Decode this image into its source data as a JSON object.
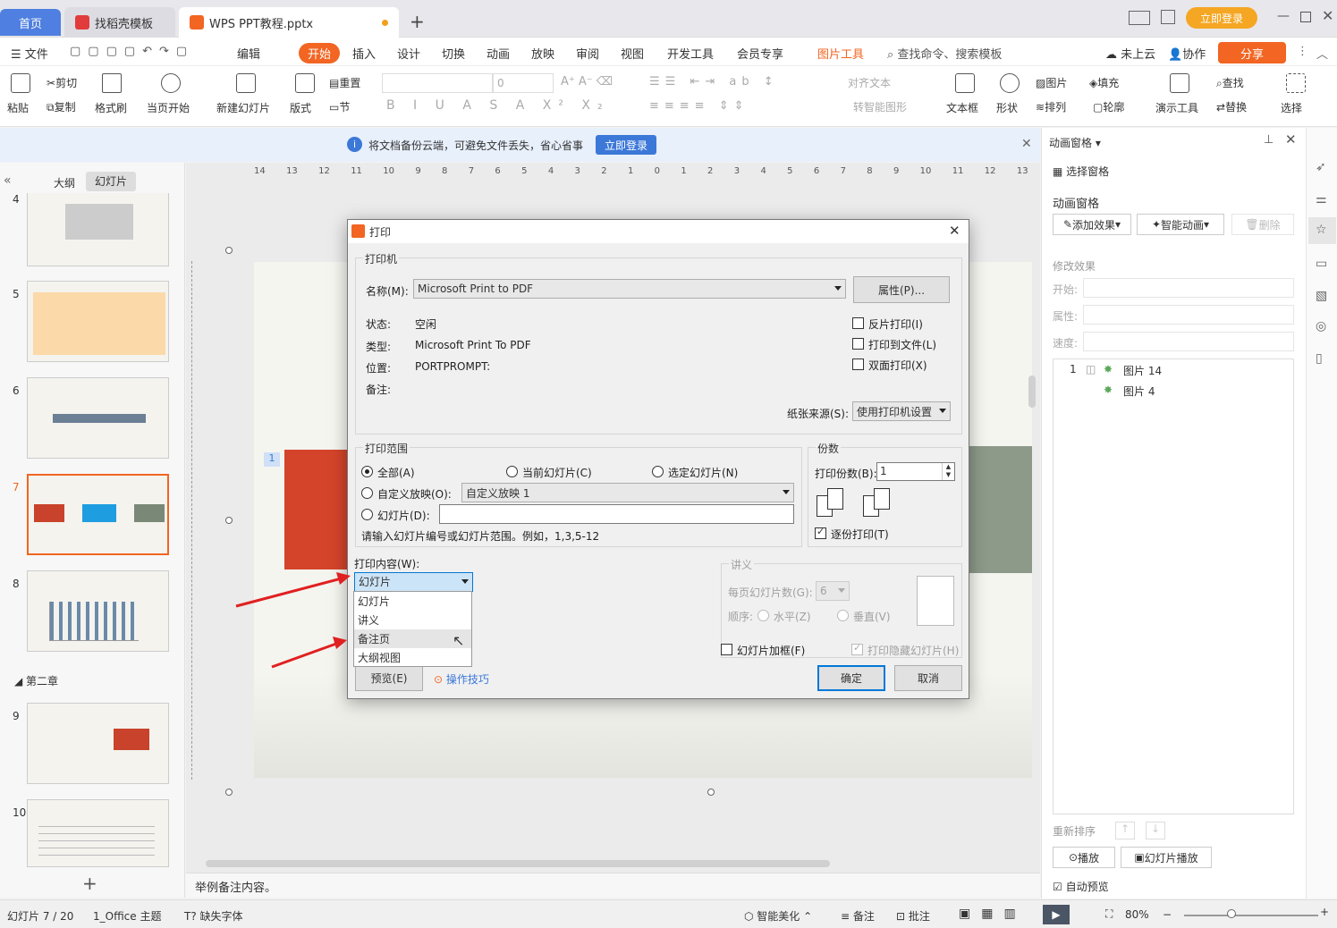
{
  "tabs": {
    "home": "首页",
    "templates": "找稻壳模板",
    "doc": "WPS PPT教程.pptx",
    "login": "立即登录"
  },
  "menu": {
    "file": "文件",
    "edit": "编辑",
    "start": "开始",
    "insert": "插入",
    "design": "设计",
    "transition": "切换",
    "animation": "动画",
    "slideshow": "放映",
    "review": "审阅",
    "view": "视图",
    "dev": "开发工具",
    "member": "会员专享",
    "picture_tools": "图片工具",
    "search": "查找命令、搜索模板",
    "cloud": "未上云",
    "collab": "协作",
    "share": "分享"
  },
  "toolbar": {
    "paste": "粘贴",
    "cut": "剪切",
    "copy": "复制",
    "format_painter": "格式刷",
    "play_current": "当页开始",
    "new_slide": "新建幻灯片",
    "layout": "版式",
    "reset": "重置",
    "section": "节",
    "font_size": "0",
    "align_text": "对齐文本",
    "smart_shape": "转智能图形",
    "textbox": "文本框",
    "shape": "形状",
    "picture": "图片",
    "fill": "填充",
    "arrange": "排列",
    "outline": "轮廓",
    "present_tools": "演示工具",
    "find": "查找",
    "replace": "替换",
    "select": "选择"
  },
  "notify": {
    "text": "将文档备份云端，可避免文件丢失，省心省事",
    "button": "立即登录"
  },
  "left_panel": {
    "tab_outline": "大纲",
    "tab_slides": "幻灯片",
    "slides": [
      "4",
      "5",
      "6",
      "7",
      "8",
      "9",
      "10"
    ],
    "section": "第二章"
  },
  "canvas": {
    "slide_number": "1",
    "ruler": [
      "14",
      "13",
      "12",
      "11",
      "10",
      "9",
      "8",
      "7",
      "6",
      "5",
      "4",
      "3",
      "2",
      "1",
      "0",
      "1",
      "2",
      "3",
      "4",
      "5",
      "6",
      "7",
      "8",
      "9",
      "10",
      "11",
      "12",
      "13"
    ],
    "notes": "举例备注内容。"
  },
  "right_panel": {
    "title": "动画窗格",
    "select_pane": "选择窗格",
    "anim_pane": "动画窗格",
    "add_effect": "添加效果",
    "smart_anim": "智能动画",
    "delete": "删除",
    "modify": "修改效果",
    "start": "开始:",
    "property": "属性:",
    "speed": "速度:",
    "items": [
      {
        "num": "1",
        "name": "图片 14"
      },
      {
        "num": "",
        "name": "图片 4"
      }
    ],
    "reorder": "重新排序",
    "play": "播放",
    "slideshow": "幻灯片播放",
    "auto_preview": "自动预览"
  },
  "dialog": {
    "title": "打印",
    "printer_group": "打印机",
    "name_label": "名称(M):",
    "name_value": "Microsoft Print to PDF",
    "properties": "属性(P)...",
    "status_label": "状态:",
    "status_value": "空闲",
    "type_label": "类型:",
    "type_value": "Microsoft Print To PDF",
    "location_label": "位置:",
    "location_value": "PORTPROMPT:",
    "comment_label": "备注:",
    "reverse": "反片打印(I)",
    "to_file": "打印到文件(L)",
    "duplex": "双面打印(X)",
    "paper_source_label": "纸张来源(S):",
    "paper_source_value": "使用打印机设置",
    "range_group": "打印范围",
    "all": "全部(A)",
    "current": "当前幻灯片(C)",
    "selected": "选定幻灯片(N)",
    "custom_show": "自定义放映(O):",
    "custom_show_value": "自定义放映 1",
    "slides_label": "幻灯片(D):",
    "range_hint": "请输入幻灯片编号或幻灯片范围。例如，1,3,5-12",
    "copies_group": "份数",
    "copies_label": "打印份数(B):",
    "copies_value": "1",
    "collate": "逐份打印(T)",
    "content_label": "打印内容(W):",
    "content_value": "幻灯片",
    "content_options": [
      "幻灯片",
      "讲义",
      "备注页",
      "大纲视图"
    ],
    "handout_group": "讲义",
    "per_page_label": "每页幻灯片数(G):",
    "per_page_value": "6",
    "order_label": "顺序:",
    "horizontal": "水平(Z)",
    "vertical": "垂直(V)",
    "frame": "幻灯片加框(F)",
    "print_hidden": "打印隐藏幻灯片(H)",
    "preview": "预览(E)",
    "tips": "操作技巧",
    "ok": "确定",
    "cancel": "取消"
  },
  "status": {
    "slide": "幻灯片 7 / 20",
    "theme": "1_Office 主题",
    "missing_font": "缺失字体",
    "beautify": "智能美化",
    "notes": "备注",
    "comment": "批注",
    "zoom": "80%"
  },
  "colors": {
    "accent": "#f26522",
    "blue": "#4f7fe0",
    "dialog_bg": "#f0f0f0"
  }
}
